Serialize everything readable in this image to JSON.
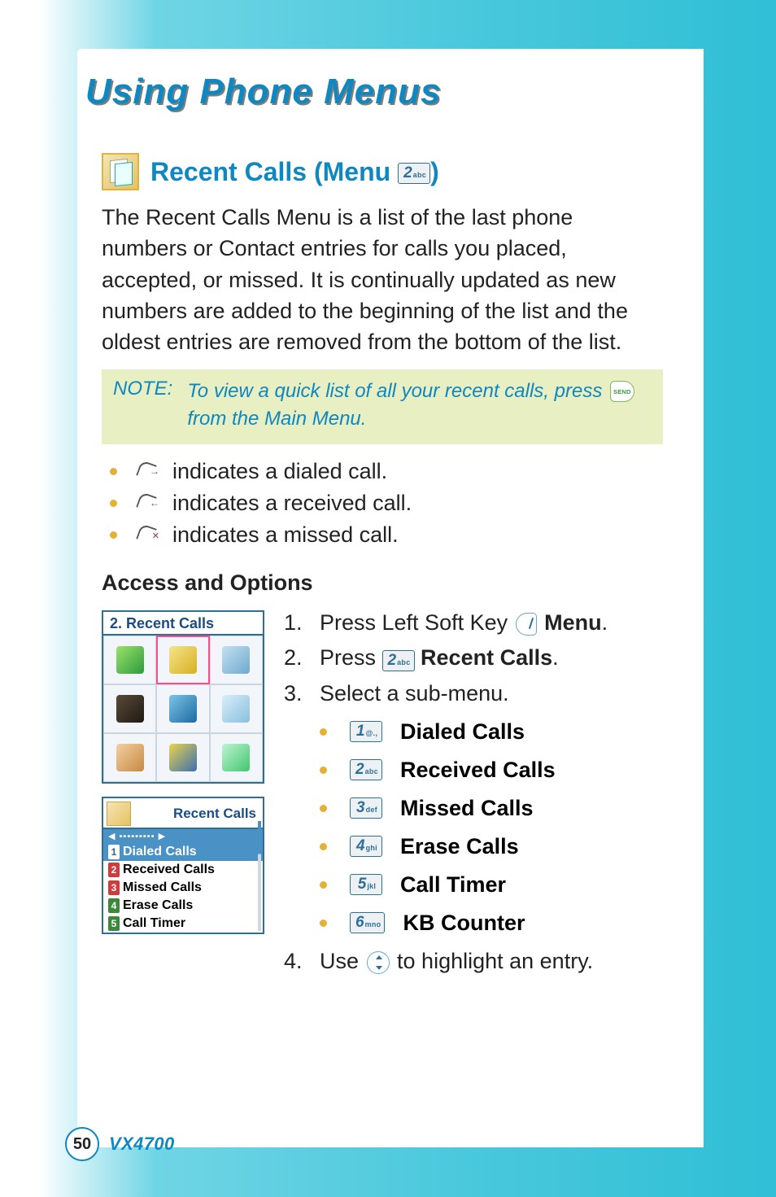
{
  "page_title": "Using Phone Menus",
  "section": {
    "title_prefix": "Recent Calls (Menu ",
    "title_suffix": ")",
    "key": {
      "digit": "2",
      "sub": "abc"
    }
  },
  "intro": "The Recent Calls Menu is a list of the last phone numbers or Contact entries for calls you placed, accepted, or missed. It is continually updated as new numbers are added to the beginning of the list and the oldest entries are removed from the bottom of the list.",
  "note": {
    "label": "NOTE:",
    "before": "To view a quick list of all your recent calls, press ",
    "after": " from the Main Menu."
  },
  "indicators": [
    " indicates a dialed call.",
    " indicates a received call.",
    " indicates a missed call."
  ],
  "access_heading": "Access and Options",
  "grid_thumb_title": "2. Recent Calls",
  "list_thumb": {
    "title": "Recent Calls",
    "items": [
      "Dialed Calls",
      "Received Calls",
      "Missed Calls",
      "Erase Calls",
      "Call Timer"
    ]
  },
  "steps": {
    "s1_num": "1.",
    "s1_before": "Press Left Soft Key ",
    "s1_bold": "Menu",
    "s1_after": ".",
    "s2_num": "2.",
    "s2_before": "Press ",
    "s2_key": {
      "digit": "2",
      "sub": "abc"
    },
    "s2_bold": "Recent Calls",
    "s2_after": ".",
    "s3_num": "3.",
    "s3_text": "Select a sub-menu.",
    "submenus": [
      {
        "key": {
          "digit": "1",
          "sub": "@.,"
        },
        "label": "Dialed Calls"
      },
      {
        "key": {
          "digit": "2",
          "sub": "abc"
        },
        "label": "Received Calls"
      },
      {
        "key": {
          "digit": "3",
          "sub": "def"
        },
        "label": "Missed Calls"
      },
      {
        "key": {
          "digit": "4",
          "sub": "ghi"
        },
        "label": "Erase Calls"
      },
      {
        "key": {
          "digit": "5",
          "sub": "jkl"
        },
        "label": "Call Timer"
      },
      {
        "key": {
          "digit": "6",
          "sub": "mno"
        },
        "label": "KB Counter"
      }
    ],
    "s4_num": "4.",
    "s4_before": "Use ",
    "s4_after": " to highlight an entry."
  },
  "footer": {
    "page": "50",
    "model": "VX4700"
  }
}
